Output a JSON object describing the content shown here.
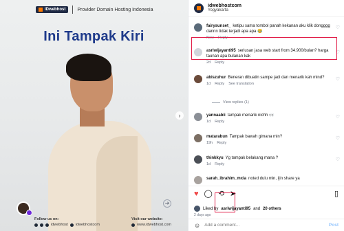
{
  "post_image": {
    "brand_logo": "IDwebhost",
    "brand_tagline": "Provider Domain Hosting Indonesia",
    "headline": "Ini Tampak Kiri",
    "footer": {
      "follow_label": "Follow us on:",
      "follow_handle": "idwebhost",
      "social_handle": "idwebhostcom",
      "visit_label": "Visit our website:",
      "visit_url": "www.idwebhost.com"
    }
  },
  "header": {
    "username": "idwebhostcom",
    "location": "Yogyakarta"
  },
  "comments": [
    {
      "user": "fairysunset_",
      "text": "ketipu sama tombol panah kekanan aku klik dongggg dannn tidak terjadi apa apa 😂",
      "time": "Now",
      "reply": "Reply"
    },
    {
      "user": "asriwijayanti95",
      "text": "seriusan jasa web start from 34.900/bulan? harga taunan apa bulanan kak",
      "time": "2d",
      "reply": "Reply"
    },
    {
      "user": "abiszuhur",
      "text": "Beneran dibuatin sampe jadi dan menarik kah mind?",
      "time": "1d",
      "reply": "Reply",
      "translate": "See translation"
    },
    {
      "user": "yannaabii",
      "text": "tampak menarik nichh 👀",
      "time": "1d",
      "reply": "Reply"
    },
    {
      "user": "matarabun",
      "text": "Tampak bawah gimana min?",
      "time": "19h",
      "reply": "Reply"
    },
    {
      "user": "thinkkyu",
      "text": "Yg tampak belakang mana ?",
      "time": "1d",
      "reply": "Reply"
    },
    {
      "user": "sarah_ibrahim_mxia",
      "text": "noted dulu min, ijin share ya",
      "time": "",
      "reply": ""
    }
  ],
  "view_replies": "View replies (1)",
  "likes": {
    "prefix": "Liked by",
    "user": "asriwijayanti95",
    "suffix": "and",
    "others": "20 others"
  },
  "date": "2 days ago",
  "add_comment": {
    "placeholder": "Add a comment...",
    "post_label": "Post"
  },
  "icons": [
    "heart-icon",
    "comment-icon",
    "repost-icon",
    "share-icon",
    "save-icon",
    "emoji-icon",
    "chevron-right-icon"
  ],
  "colors": {
    "highlight": "#e11d48",
    "headline": "#1e3a8a",
    "heart": "#ef4444"
  }
}
